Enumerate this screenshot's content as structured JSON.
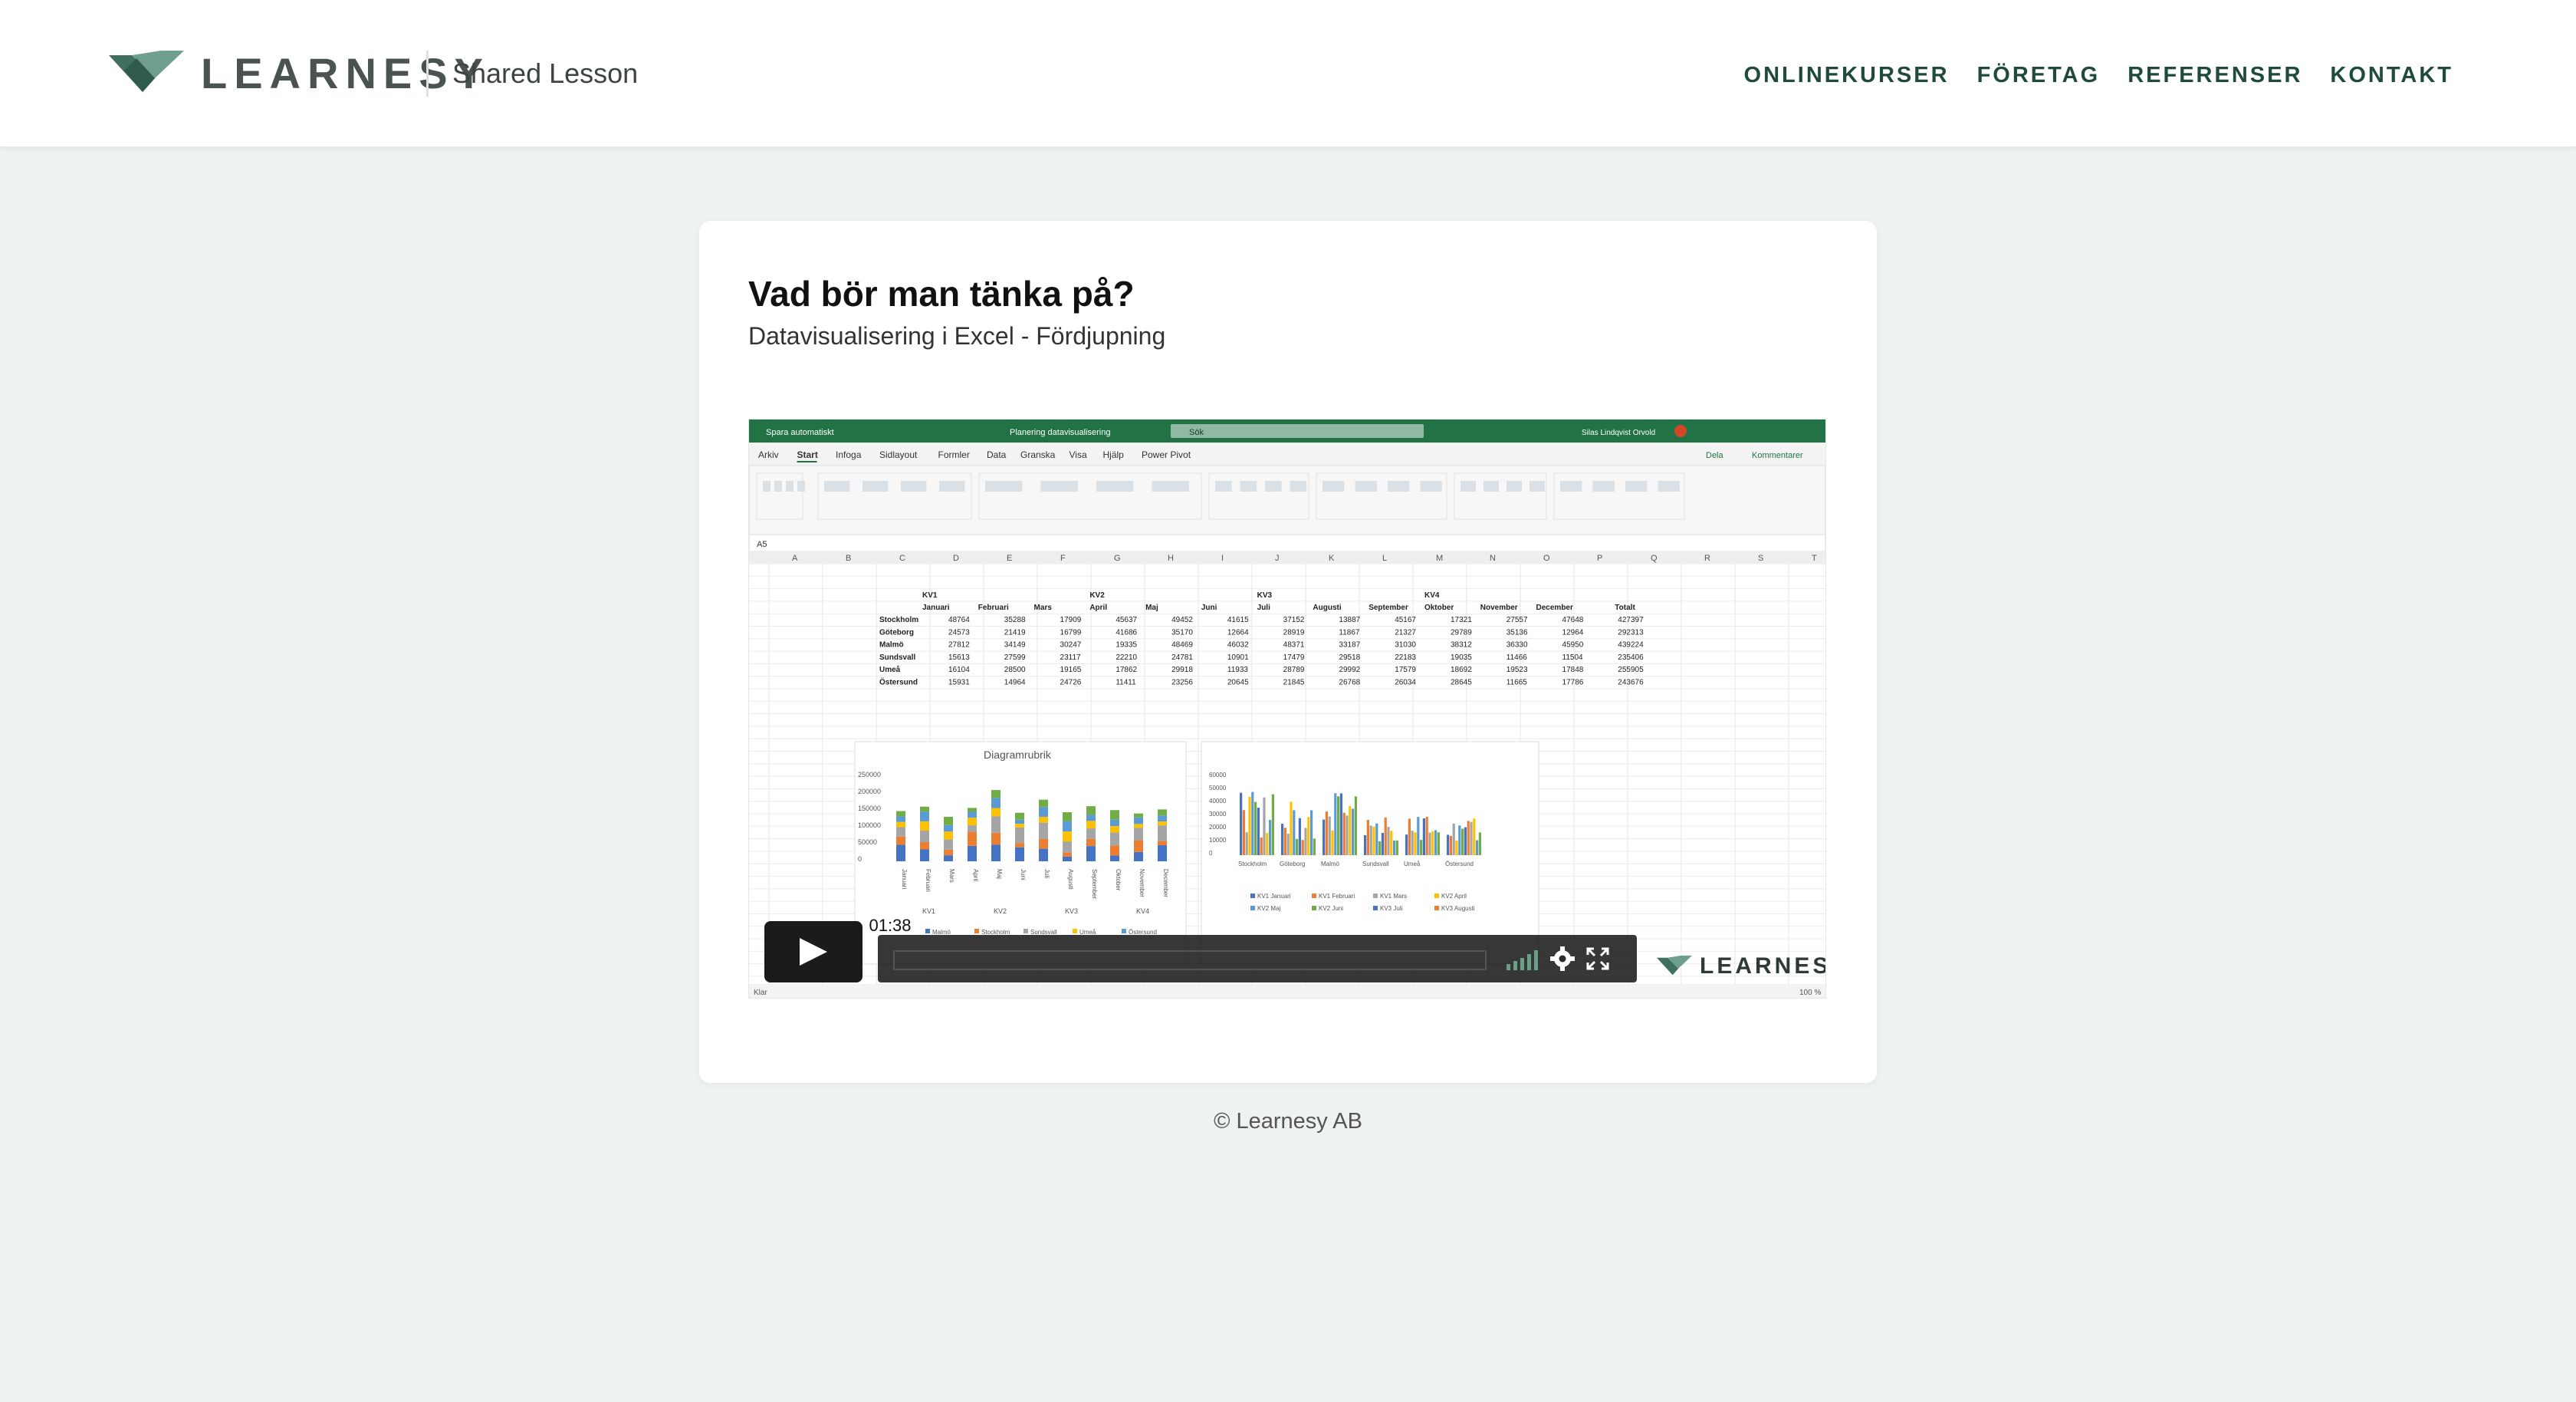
{
  "header": {
    "brand": "LEARNESY",
    "section": "Shared Lesson",
    "nav": [
      "ONLINEKURSER",
      "FÖRETAG",
      "REFERENSER",
      "KONTAKT"
    ]
  },
  "lesson": {
    "title": "Vad bör man tänka på?",
    "subtitle": "Datavisualisering i Excel - Fördjupning"
  },
  "video": {
    "duration": "01:38",
    "watermark": "LEARNESY",
    "frame": {
      "titlebar": {
        "autosave": "Spara automatiskt",
        "doc": "Planering datavisualisering",
        "search": "Sök",
        "user": "Silas Lindqvist Orvold"
      },
      "menu": [
        "Arkiv",
        "Start",
        "Infoga",
        "Sidlayout",
        "Formler",
        "Data",
        "Granska",
        "Visa",
        "Hjälp",
        "Power Pivot"
      ],
      "share": "Dela",
      "comments": "Kommentarer",
      "namebox": "A5",
      "columns": [
        "A",
        "B",
        "C",
        "D",
        "E",
        "F",
        "G",
        "H",
        "I",
        "J",
        "K",
        "L",
        "M",
        "N",
        "O",
        "P",
        "Q",
        "R",
        "S",
        "T"
      ],
      "quarters": [
        "KV1",
        "KV2",
        "KV3",
        "KV4"
      ],
      "months": [
        "Januari",
        "Februari",
        "Mars",
        "April",
        "Maj",
        "Juni",
        "Juli",
        "Augusti",
        "September",
        "Oktober",
        "November",
        "December"
      ],
      "total_label": "Totalt",
      "rows": [
        {
          "city": "Stockholm",
          "values": [
            48764,
            35288,
            17909,
            45637,
            49452,
            41615,
            37152,
            13887,
            45167,
            17321,
            27557,
            47648
          ],
          "total": 427397
        },
        {
          "city": "Göteborg",
          "values": [
            24573,
            21419,
            16799,
            41686,
            35170,
            12664,
            28919,
            11867,
            21327,
            29789,
            35136,
            12964
          ],
          "total": 292313
        },
        {
          "city": "Malmö",
          "values": [
            27812,
            34149,
            30247,
            19335,
            48469,
            46032,
            48371,
            33187,
            31030,
            38312,
            36330,
            45950
          ],
          "total": 439224
        },
        {
          "city": "Sundsvall",
          "values": [
            15613,
            27599,
            23117,
            22210,
            24781,
            10901,
            17479,
            29518,
            22183,
            19035,
            11466,
            11504
          ],
          "total": 235406
        },
        {
          "city": "Umeå",
          "values": [
            16104,
            28500,
            19165,
            17862,
            29918,
            11933,
            28789,
            29992,
            17579,
            18692,
            19523,
            17848
          ],
          "total": 255905
        },
        {
          "city": "Östersund",
          "values": [
            15931,
            14964,
            24726,
            11411,
            23256,
            20645,
            21845,
            26768,
            26034,
            28645,
            11665,
            17786
          ],
          "total": 243676
        }
      ],
      "chart1_title": "Diagramrubrik",
      "chart1_yticks": [
        "250000",
        "200000",
        "150000",
        "100000",
        "50000",
        "0"
      ],
      "chart2_yticks": [
        "60000",
        "50000",
        "40000",
        "30000",
        "20000",
        "10000",
        "0"
      ],
      "chart2_cats": [
        "Stockholm",
        "Göteborg",
        "Malmö",
        "Sundsvall",
        "Umeå",
        "Östersund"
      ],
      "legend2": [
        "KV1 Januari",
        "KV1 Februari",
        "KV1 Mars",
        "KV2 April",
        "KV2 Maj",
        "KV2 Juni",
        "KV3 Juli",
        "KV3 Augusti"
      ],
      "legend1": [
        "Malmö",
        "Stockholm",
        "Sundsvall",
        "Umeå",
        "Östersund"
      ],
      "status": "Klar",
      "zoom": "100 %"
    },
    "colors": {
      "excel_green": "#217346",
      "series": [
        "#4472c4",
        "#ed7d31",
        "#a5a5a5",
        "#ffc000",
        "#5b9bd5",
        "#70ad47"
      ]
    }
  },
  "footer": {
    "copyright": "© Learnesy AB"
  }
}
